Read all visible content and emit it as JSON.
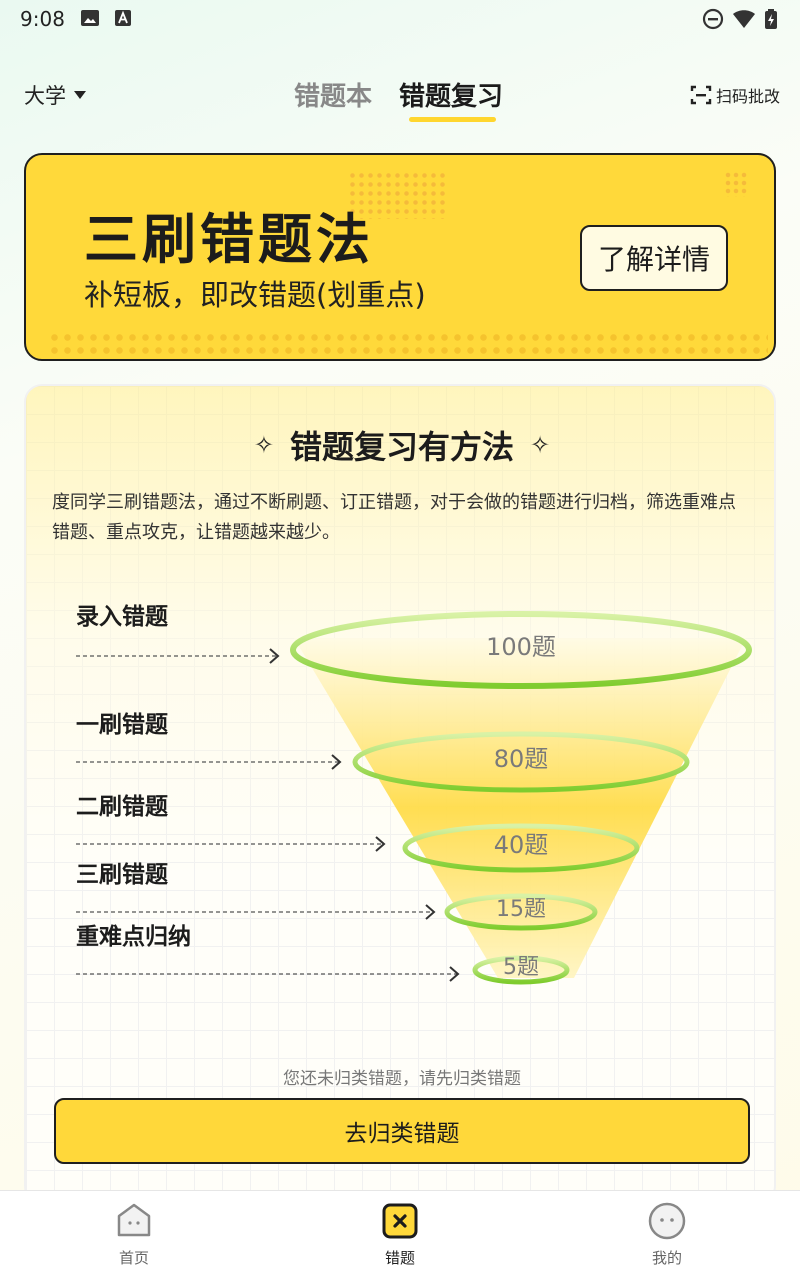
{
  "status_bar": {
    "time": "9:08"
  },
  "header": {
    "grade": "大学",
    "tabs": [
      {
        "label": "错题本",
        "active": false
      },
      {
        "label": "错题复习",
        "active": true
      }
    ],
    "scan_label": "扫码批改"
  },
  "banner": {
    "title": "三刷错题法",
    "subtitle": "补短板，即改错题(划重点)",
    "button_label": "了解详情"
  },
  "method": {
    "title": "错题复习有方法",
    "description": "度同学三刷错题法，通过不断刷题、订正错题，对于会做的错题进行归档，筛选重难点错题、重点攻克，让错题越来越少。",
    "funnel": [
      {
        "stage": "录入错题",
        "count": "100题"
      },
      {
        "stage": "一刷错题",
        "count": "80题"
      },
      {
        "stage": "二刷错题",
        "count": "40题"
      },
      {
        "stage": "三刷错题",
        "count": "15题"
      },
      {
        "stage": "重难点归纳",
        "count": "5题"
      }
    ],
    "hint": "您还未归类错题，请先归类错题",
    "button_label": "去归类错题"
  },
  "bottom_nav": [
    {
      "label": "首页",
      "icon": "home-icon",
      "active": false
    },
    {
      "label": "错题",
      "icon": "mistakes-icon",
      "active": true
    },
    {
      "label": "我的",
      "icon": "profile-icon",
      "active": false
    }
  ],
  "colors": {
    "accent": "#ffd83a",
    "ring_green": "#8fd43e",
    "text": "#1c1c1c"
  }
}
